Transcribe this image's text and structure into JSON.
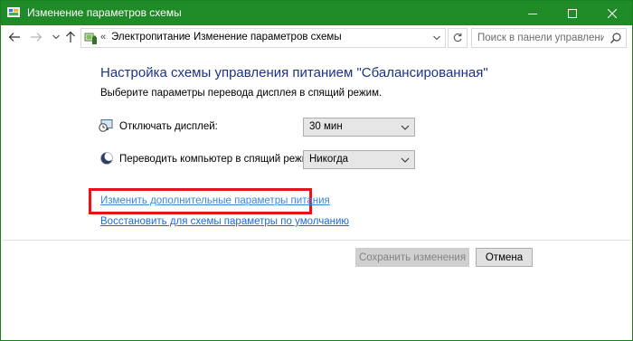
{
  "window": {
    "title": "Изменение параметров схемы",
    "accent_color": "#1e8b26"
  },
  "nav": {
    "breadcrumb_overflow": "«",
    "breadcrumbs": [
      "Электропитание",
      "Изменение параметров схемы"
    ],
    "breadcrumb_separator": "›",
    "search_placeholder": "Поиск в панели управления"
  },
  "main": {
    "heading": "Настройка схемы управления питанием \"Сбалансированная\"",
    "subtitle": "Выберите параметры перевода дисплея в спящий режим.",
    "display_off": {
      "label": "Отключать дисплей:",
      "value": "30 мин",
      "icon": "monitor-clock-icon"
    },
    "sleep": {
      "label": "Переводить компьютер в спящий режим:",
      "value": "Никогда",
      "icon": "moon-icon"
    },
    "advanced_link": "Изменить дополнительные параметры питания",
    "restore_link": "Восстановить для схемы параметры по умолчанию",
    "highlight_color": "#e8121b"
  },
  "footer": {
    "save_label": "Сохранить изменения",
    "cancel_label": "Отмена"
  }
}
